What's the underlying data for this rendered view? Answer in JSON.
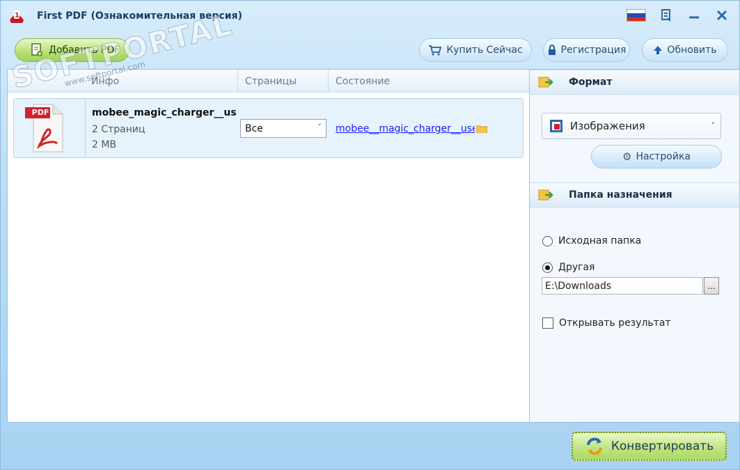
{
  "window": {
    "title": "First PDF (Ознакомительная версия)"
  },
  "toolbar": {
    "add_pdf": "Добавить PDF",
    "buy_now": "Купить Сейчас",
    "register": "Регистрация",
    "update": "Обновить"
  },
  "file_list": {
    "columns": [
      "Инфо",
      "Страницы",
      "Состояние"
    ],
    "rows": [
      {
        "thumb_label": "PDF",
        "name": "mobee_magic_charger__user",
        "pages": "2 Страниц",
        "size": "2 MB",
        "page_range": "Все",
        "status": "mobee__magic_charger__user"
      }
    ]
  },
  "format": {
    "heading": "Формат",
    "selected": "Изображения",
    "settings_button": "Настройка"
  },
  "destination": {
    "heading": "Папка назначения",
    "option_source": "Исходная папка",
    "option_other": "Другая",
    "selected_option": "Другая",
    "path": "E:\\Downloads",
    "browse_label": "...",
    "open_result_label": "Открывать результат",
    "open_result_checked": false
  },
  "convert_button": "Конвертировать",
  "watermark": {
    "main": "SOFTPORTAL",
    "sub": "www.softportal.com"
  },
  "colors": {
    "accent_green": "#a9d862",
    "accent_blue": "#2b6aa8",
    "flag_white": "#ffffff",
    "flag_blue": "#1c4fb5",
    "flag_red": "#d52b1e"
  }
}
